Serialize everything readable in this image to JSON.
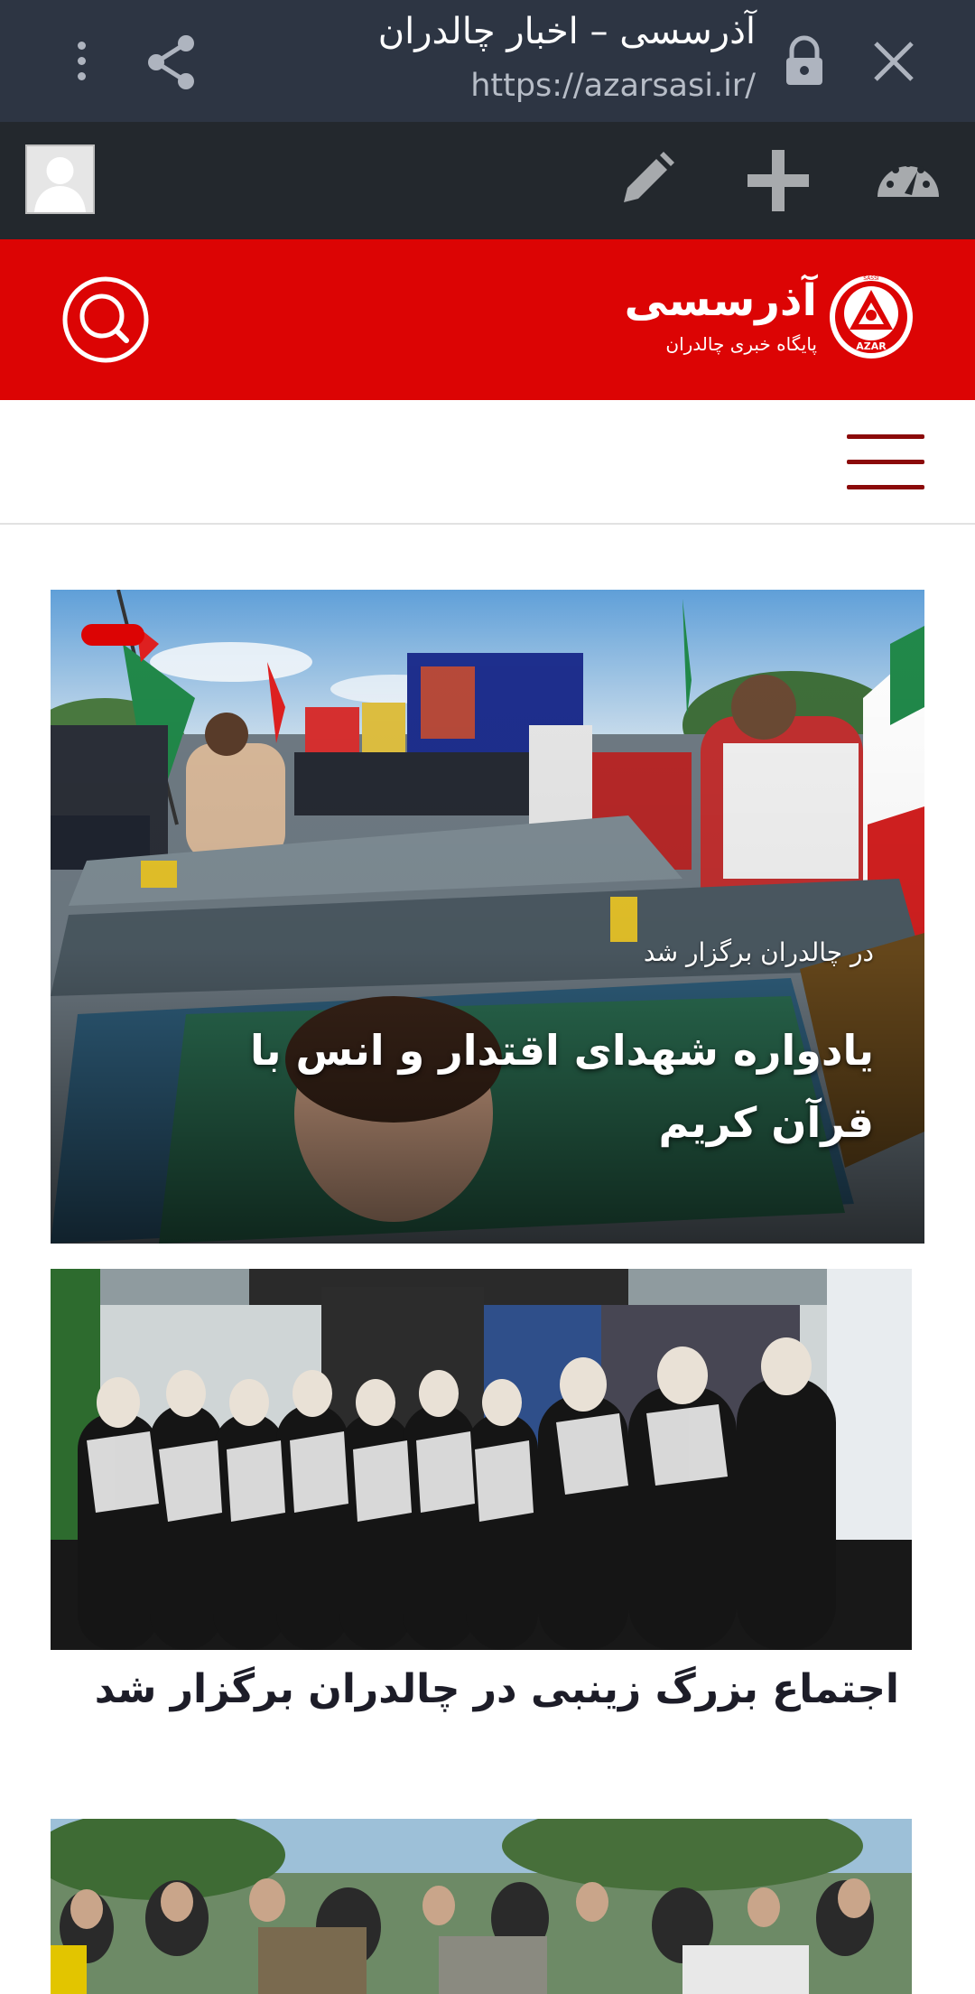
{
  "browser": {
    "title": "آذرسسی – اخبار چالدران",
    "url": "https://azarsasi.ir/",
    "icons": [
      "menu-icon",
      "share-icon",
      "lock-icon",
      "close-icon"
    ]
  },
  "admin_bar": {
    "icons": [
      "avatar",
      "edit-icon",
      "plus-icon",
      "dashboard-icon"
    ]
  },
  "site_header": {
    "background_color": "#dc0404",
    "logo": {
      "name": "آذرسسی",
      "tagline": "پایگاه خبری چالدران",
      "mark_text": "AZAR",
      "mark_small": "SASSI"
    },
    "icons": [
      "search-icon"
    ]
  },
  "nav": {
    "icons": [
      "hamburger-icon"
    ]
  },
  "posts": [
    {
      "subtitle": "در چالدران برگزار شد",
      "title": "یادواره شهدای اقتدار و انس با قرآن کریم"
    },
    {
      "title": "اجتماع بزرگ زینبی در چالدران برگزار شد"
    },
    {
      "title": ""
    }
  ]
}
